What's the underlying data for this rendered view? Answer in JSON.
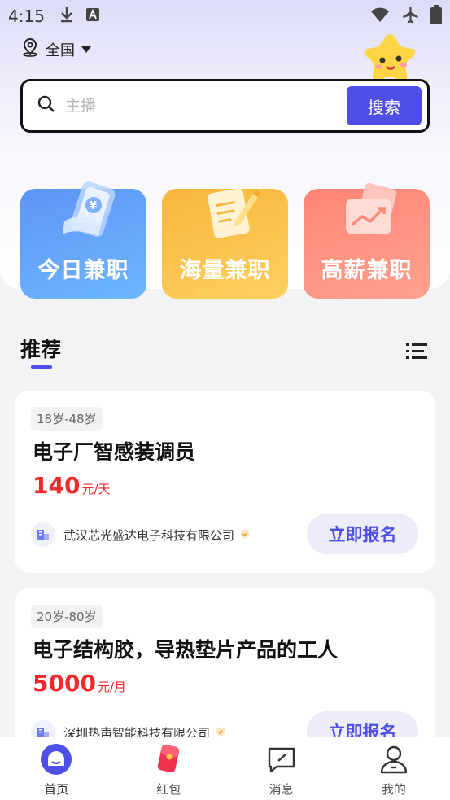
{
  "status_bar": {
    "time": "4:15",
    "left_icons": [
      "download-icon",
      "font-a-icon"
    ],
    "right_icons": [
      "wifi-icon",
      "airplane-icon",
      "battery-icon"
    ]
  },
  "header": {
    "location": "全国",
    "location_icon": "location-pin-icon",
    "dropdown_icon": "caret-down-icon"
  },
  "search": {
    "placeholder": "主播",
    "button_label": "搜索"
  },
  "categories": [
    {
      "label": "今日兼职",
      "icon": "money-phone-icon",
      "color": "#5e94f5"
    },
    {
      "label": "海量兼职",
      "icon": "notepad-pen-icon",
      "color": "#f8b63b"
    },
    {
      "label": "高薪兼职",
      "icon": "wallet-chart-icon",
      "color": "#ff8574"
    }
  ],
  "section": {
    "title": "推荐",
    "toggle_icon": "list-view-icon"
  },
  "jobs": [
    {
      "age_range": "18岁-48岁",
      "title": "电子厂智感装调员",
      "salary_amount": "140",
      "salary_unit": "元/天",
      "company": "武汉芯光盛达电子科技有限公司",
      "verified_icon": "verified-check-icon",
      "apply_label": "立即报名"
    },
    {
      "age_range": "20岁-80岁",
      "title": "电子结构胶，导热垫片产品的工人",
      "salary_amount": "5000",
      "salary_unit": "元/月",
      "company": "深圳热声智能科技有限公司",
      "verified_icon": "verified-check-icon",
      "apply_label": "立即报名"
    }
  ],
  "bottom_nav": [
    {
      "label": "首页",
      "icon": "home-face-icon",
      "active": true
    },
    {
      "label": "红包",
      "icon": "red-envelope-icon",
      "active": false
    },
    {
      "label": "消息",
      "icon": "message-icon",
      "active": false
    },
    {
      "label": "我的",
      "icon": "profile-icon",
      "active": false
    }
  ],
  "colors": {
    "accent": "#4e4fe6",
    "salary": "#ee2a2a",
    "background": "#f3f3f5"
  }
}
